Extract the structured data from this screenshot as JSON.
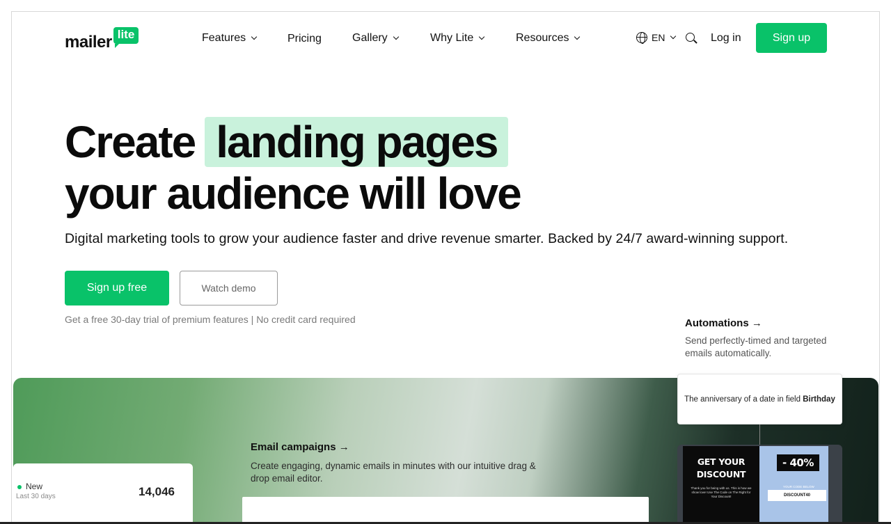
{
  "brand": {
    "name": "mailer",
    "badge": "lite",
    "accent": "#09c269"
  },
  "nav": {
    "items": [
      {
        "label": "Features",
        "dropdown": true
      },
      {
        "label": "Pricing",
        "dropdown": false
      },
      {
        "label": "Gallery",
        "dropdown": true
      },
      {
        "label": "Why Lite",
        "dropdown": true
      },
      {
        "label": "Resources",
        "dropdown": true
      }
    ],
    "language": "EN",
    "login": "Log in",
    "signup": "Sign up"
  },
  "hero": {
    "title_line1_a": "Create",
    "title_line1_highlight": "landing pages",
    "title_line2": "your audience will love",
    "subtitle": "Digital marketing tools to grow your audience faster and drive revenue smarter. Backed by 24/7 award-winning support.",
    "cta_primary": "Sign up free",
    "cta_secondary": "Watch demo",
    "trial_note": "Get a free 30-day trial of premium features | No credit card required",
    "highlight_color": "#c9f2dc"
  },
  "features": {
    "automations": {
      "title": "Automations →",
      "desc": "Send perfectly-timed and targeted emails automatically."
    },
    "email_campaigns": {
      "title": "Email campaigns →",
      "desc": "Create engaging, dynamic emails in minutes with our intuitive drag & drop email editor."
    }
  },
  "stats": {
    "label": "New",
    "period": "Last 30 days",
    "value": "14,046"
  },
  "automation_card": {
    "text": "The anniversary of a date in field",
    "field": "Birthday"
  },
  "promo": {
    "title_line1": "GET YOUR",
    "title_line2": "DISCOUNT",
    "fine_print": "Thank you for being with us. This is how we show love! Use The Code on The Right for Your Discount!",
    "percent": "- 40%",
    "code_label": "YOUR CODE BELOW",
    "code": "DISCOUNT40"
  }
}
